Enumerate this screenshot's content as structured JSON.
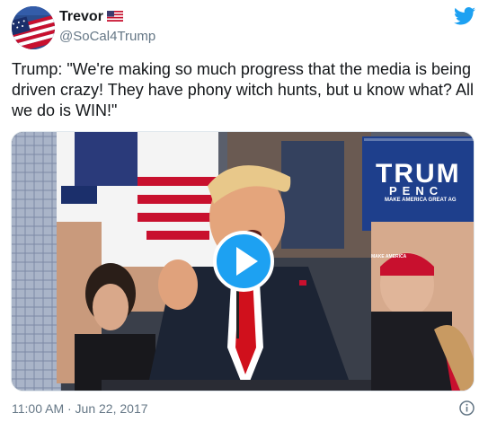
{
  "author": {
    "display_name": "Trevor",
    "handle": "@SoCal4Trump",
    "avatar_icon": "american-flag-avatar",
    "name_badge_icon": "us-flag-emoji"
  },
  "tweet": {
    "text": "Trump: \"We're making so much progress that the media is being driven crazy! They have phony witch hunts, but u know what? All we do is WIN!\"",
    "timestamp": "11:00 AM · Jun 22, 2017"
  },
  "media": {
    "type": "video",
    "play_icon": "play-icon",
    "sign_line_1": "TRUM",
    "sign_line_2": "PENC",
    "sign_line_3": "MAKE AMERICA GREAT AG",
    "hat_text": "MAKE AMERICA"
  },
  "colors": {
    "brand_blue": "#1da1f2",
    "secondary_text": "#657786",
    "primary_text": "#14171a"
  }
}
